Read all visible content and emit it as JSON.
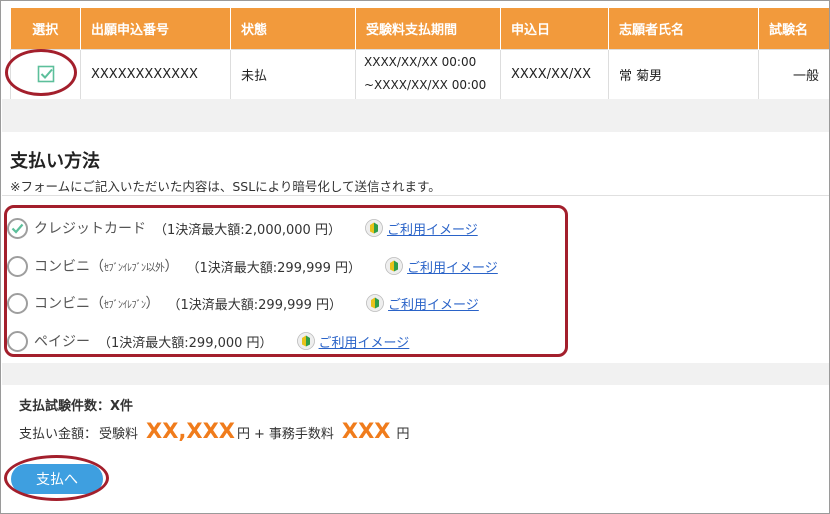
{
  "table": {
    "headers": {
      "select": "選択",
      "application_no": "出願申込番号",
      "status": "状態",
      "payment_period": "受験料支払期間",
      "applied_date": "申込日",
      "applicant_name": "志願者氏名",
      "exam_name": "試験名"
    },
    "row": {
      "application_no": "XXXXXXXXXXXX",
      "status": "未払",
      "period_start": "XXXX/XX/XX 00:00",
      "period_end": "~XXXX/XX/XX 00:00",
      "applied_date": "XXXX/XX/XX",
      "applicant_name": "常 菊男",
      "exam_type": "一般"
    }
  },
  "payment": {
    "title": "支払い方法",
    "note": "※フォームにご記入いただいた内容は、SSLにより暗号化して送信されます。",
    "options": [
      {
        "label": "クレジットカード",
        "sub": "",
        "limit": "（1決済最大額:2,000,000 円）",
        "link": "ご利用イメージ",
        "selected": true
      },
      {
        "label": "コンビニ（",
        "sub": "ｾﾌﾞﾝｲﾚﾌﾞﾝ以外",
        "suffix": "）",
        "limit": "（1決済最大額:299,999 円）",
        "link": "ご利用イメージ",
        "selected": false
      },
      {
        "label": "コンビニ（",
        "sub": "ｾﾌﾞﾝｲﾚﾌﾞﾝ",
        "suffix": "）",
        "limit": "（1決済最大額:299,999 円）",
        "link": "ご利用イメージ",
        "selected": false
      },
      {
        "label": "ペイジー",
        "sub": "",
        "limit": "（1決済最大額:299,000 円）",
        "link": "ご利用イメージ",
        "selected": false
      }
    ]
  },
  "summary": {
    "count_label": "支払試験件数：",
    "count_value": "X件",
    "amount_label": "支払い金額：",
    "exam_fee_label": "受験料",
    "exam_fee_value": "XX,XXX",
    "yen1": "円",
    "plus": "+",
    "fee_label": "事務手数料",
    "fee_value": "XXX",
    "yen2": "円"
  },
  "pay_button": "支払へ",
  "colors": {
    "header": "#f29a3c",
    "accent": "#f07c1c",
    "link": "#2a63c8",
    "button": "#3e9fe0",
    "annotation": "#a31f2c",
    "check": "#5cbf9b"
  }
}
